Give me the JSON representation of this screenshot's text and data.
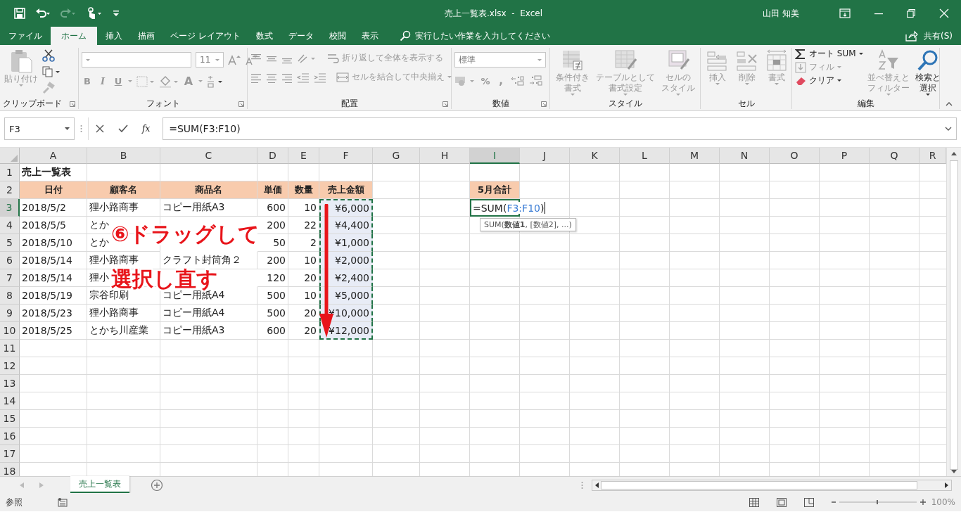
{
  "window": {
    "title": "売上一覧表.xlsx  -  Excel",
    "user": "山田 知美"
  },
  "ribbon_tabs": [
    {
      "label": "ファイル",
      "selected": false
    },
    {
      "label": "ホーム",
      "selected": true
    },
    {
      "label": "挿入",
      "selected": false
    },
    {
      "label": "描画",
      "selected": false
    },
    {
      "label": "ページ レイアウト",
      "selected": false
    },
    {
      "label": "数式",
      "selected": false
    },
    {
      "label": "データ",
      "selected": false
    },
    {
      "label": "校閲",
      "selected": false
    },
    {
      "label": "表示",
      "selected": false
    }
  ],
  "tell_me": {
    "placeholder": "実行したい作業を入力してください"
  },
  "share": "共有(S)",
  "ribbon_groups": [
    {
      "kind": "clipboard",
      "label": "クリップボード",
      "paste": {
        "label": "貼り付け",
        "disabled": true
      }
    },
    {
      "kind": "font",
      "label": "フォント",
      "font_size": "11",
      "format_buttons": [
        "B",
        "I",
        "U"
      ],
      "font_color": "A"
    },
    {
      "kind": "alignment",
      "label": "配置",
      "wrap": "折り返して全体を表示する",
      "merge": "セルを結合して中央揃え"
    },
    {
      "kind": "number",
      "label": "数値",
      "format": "標準",
      "percent": "%",
      "comma": ","
    },
    {
      "kind": "styles",
      "label": "スタイル",
      "buttons": [
        {
          "lines": [
            "条件付き",
            "書式"
          ],
          "disabled": true
        },
        {
          "lines": [
            "テーブルとして",
            "書式設定"
          ],
          "disabled": true
        },
        {
          "lines": [
            "セルの",
            "スタイル"
          ],
          "disabled": true
        }
      ]
    },
    {
      "kind": "cells",
      "label": "セル",
      "buttons": [
        {
          "lines": [
            "挿入"
          ],
          "disabled": true
        },
        {
          "lines": [
            "削除"
          ],
          "disabled": true
        },
        {
          "lines": [
            "書式"
          ],
          "disabled": true
        }
      ]
    },
    {
      "kind": "editing",
      "label": "編集",
      "items": [
        {
          "kind": "autosum",
          "lines": [
            "オート SUM"
          ],
          "disabled": false
        },
        {
          "kind": "fill",
          "lines": [
            "フィル"
          ],
          "disabled": true
        },
        {
          "kind": "clear",
          "lines": [
            "クリア"
          ],
          "disabled": false
        },
        {
          "kind": "sort",
          "lines": [
            "並べ替えと",
            "フィルター"
          ],
          "disabled": true
        },
        {
          "kind": "find",
          "lines": [
            "検索と",
            "選択"
          ],
          "disabled": false
        }
      ]
    }
  ],
  "formula_bar": {
    "name_box": "F3",
    "function_label": "fx",
    "formula": "=SUM(F3:F10)"
  },
  "sheet": {
    "columns": [
      {
        "label": "A",
        "selected": false
      },
      {
        "label": "B",
        "selected": false
      },
      {
        "label": "C",
        "selected": false
      },
      {
        "label": "D",
        "selected": false
      },
      {
        "label": "E",
        "selected": false
      },
      {
        "label": "F",
        "selected": false
      },
      {
        "label": "G",
        "selected": false
      },
      {
        "label": "H",
        "selected": false
      },
      {
        "label": "I",
        "selected": true
      },
      {
        "label": "J",
        "selected": false
      },
      {
        "label": "K",
        "selected": false
      },
      {
        "label": "L",
        "selected": false
      },
      {
        "label": "M",
        "selected": false
      },
      {
        "label": "N",
        "selected": false
      },
      {
        "label": "O",
        "selected": false
      },
      {
        "label": "P",
        "selected": false
      },
      {
        "label": "Q",
        "selected": false
      },
      {
        "label": "R",
        "selected": false
      }
    ],
    "rows": [
      {
        "header": "1",
        "selected": false,
        "in_range": false,
        "cells": [
          {
            "text": "売上一覧表",
            "kind": "title"
          }
        ]
      },
      {
        "header": "2",
        "selected": false,
        "in_range": false,
        "cells": [
          {
            "text": "日付",
            "kind": "header"
          },
          {
            "text": "顧客名",
            "kind": "header"
          },
          {
            "text": "商品名",
            "kind": "header"
          },
          {
            "text": "単価",
            "kind": "header"
          },
          {
            "text": "数量",
            "kind": "header"
          },
          {
            "text": "売上金額",
            "kind": "header"
          }
        ],
        "side": {
          "text": "5月合計",
          "kind": "header"
        }
      },
      {
        "header": "3",
        "selected": true,
        "in_range": true,
        "cells": [
          {
            "text": "2018/5/2",
            "kind": "text"
          },
          {
            "text": "狸小路商事",
            "kind": "text"
          },
          {
            "text": "コピー用紙A3",
            "kind": "text"
          },
          {
            "text": "600",
            "kind": "number"
          },
          {
            "text": "10",
            "kind": "number"
          },
          {
            "text": "¥6,000",
            "kind": "number"
          }
        ],
        "editing": {
          "before": "=SUM(",
          "ref": "F3:F10",
          "after": ")",
          "hint": "SUM(**数値1**, [数値2], ...)"
        }
      },
      {
        "header": "4",
        "selected": false,
        "in_range": true,
        "cells": [
          {
            "text": "2018/5/5",
            "kind": "text"
          },
          {
            "text": "とか",
            "kind": "text"
          },
          null,
          {
            "text": "200",
            "kind": "number"
          },
          {
            "text": "22",
            "kind": "number"
          },
          {
            "text": "¥4,400",
            "kind": "number"
          }
        ]
      },
      {
        "header": "5",
        "selected": false,
        "in_range": true,
        "cells": [
          {
            "text": "2018/5/10",
            "kind": "text"
          },
          {
            "text": "とか",
            "kind": "text"
          },
          null,
          {
            "text": "50",
            "kind": "number"
          },
          {
            "text": "2",
            "kind": "number"
          },
          {
            "text": "¥1,000",
            "kind": "number"
          }
        ]
      },
      {
        "header": "6",
        "selected": false,
        "in_range": true,
        "cells": [
          {
            "text": "2018/5/14",
            "kind": "text"
          },
          {
            "text": "狸小路商事",
            "kind": "text"
          },
          {
            "text": "クラフト封筒角２",
            "kind": "text"
          },
          {
            "text": "200",
            "kind": "number"
          },
          {
            "text": "10",
            "kind": "number"
          },
          {
            "text": "¥2,000",
            "kind": "number"
          }
        ]
      },
      {
        "header": "7",
        "selected": false,
        "in_range": true,
        "cells": [
          {
            "text": "2018/5/14",
            "kind": "text"
          },
          {
            "text": "狸小",
            "kind": "text"
          },
          null,
          {
            "text": "120",
            "kind": "number"
          },
          {
            "text": "20",
            "kind": "number"
          },
          {
            "text": "¥2,400",
            "kind": "number"
          }
        ]
      },
      {
        "header": "8",
        "selected": false,
        "in_range": true,
        "cells": [
          {
            "text": "2018/5/19",
            "kind": "text"
          },
          {
            "text": "宗谷印刷",
            "kind": "text"
          },
          {
            "text": "コピー用紙A4",
            "kind": "text"
          },
          {
            "text": "500",
            "kind": "number"
          },
          {
            "text": "10",
            "kind": "number"
          },
          {
            "text": "¥5,000",
            "kind": "number"
          }
        ]
      },
      {
        "header": "9",
        "selected": false,
        "in_range": true,
        "cells": [
          {
            "text": "2018/5/23",
            "kind": "text"
          },
          {
            "text": "狸小路商事",
            "kind": "text"
          },
          {
            "text": "コピー用紙A4",
            "kind": "text"
          },
          {
            "text": "500",
            "kind": "number"
          },
          {
            "text": "20",
            "kind": "number"
          },
          {
            "text": "¥10,000",
            "kind": "number"
          }
        ]
      },
      {
        "header": "10",
        "selected": false,
        "in_range": true,
        "cells": [
          {
            "text": "2018/5/25",
            "kind": "text"
          },
          {
            "text": "とかち川産業",
            "kind": "text"
          },
          {
            "text": "コピー用紙A3",
            "kind": "text"
          },
          {
            "text": "600",
            "kind": "number"
          },
          {
            "text": "20",
            "kind": "number"
          },
          {
            "text": "¥12,000",
            "kind": "number"
          }
        ]
      },
      {
        "header": "11",
        "selected": false,
        "in_range": false,
        "cells": []
      },
      {
        "header": "12",
        "selected": false,
        "in_range": false,
        "cells": []
      },
      {
        "header": "13",
        "selected": false,
        "in_range": false,
        "cells": []
      },
      {
        "header": "14",
        "selected": false,
        "in_range": false,
        "cells": []
      },
      {
        "header": "15",
        "selected": false,
        "in_range": false,
        "cells": []
      },
      {
        "header": "16",
        "selected": false,
        "in_range": false,
        "cells": []
      },
      {
        "header": "17",
        "selected": false,
        "in_range": false,
        "cells": []
      },
      {
        "header": "18",
        "selected": false,
        "in_range": false,
        "cells": []
      }
    ]
  },
  "callout": {
    "lines": [
      "⑥ドラッグして",
      "選択し直す"
    ]
  },
  "sheet_tabs": [
    {
      "label": "売上一覧表",
      "selected": true
    }
  ],
  "status_bar": {
    "mode": "参照",
    "zoom": "100%"
  }
}
